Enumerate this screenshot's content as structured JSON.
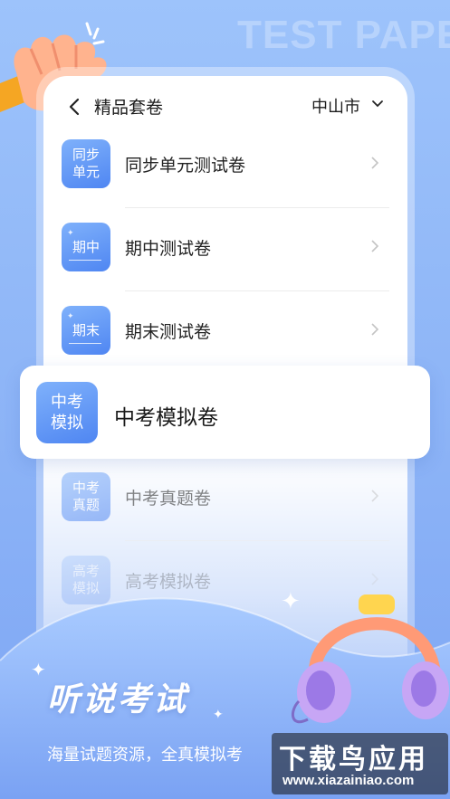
{
  "background_text": "TEST PAPE",
  "nav": {
    "title": "精品套卷",
    "city": "中山市"
  },
  "list": [
    {
      "tile": "同步\n单元",
      "label": "同步单元测试卷"
    },
    {
      "tile": "期中",
      "label": "期中测试卷"
    },
    {
      "tile": "期末",
      "label": "期末测试卷"
    },
    {
      "tile": "中考\n真题",
      "label": "中考真题卷"
    },
    {
      "tile": "高考\n模拟",
      "label": "高考模拟卷"
    }
  ],
  "highlight": {
    "tile": "中考\n模拟",
    "label": "中考模拟卷"
  },
  "promo": {
    "title": "听说考试",
    "subtitle": "海量试题资源，全真模拟考"
  },
  "watermark": {
    "main": "下载鸟应用",
    "url": "www.xiazainiao.com"
  },
  "colors": {
    "accent": "#4f86f2",
    "background": "#8fb6f7"
  }
}
